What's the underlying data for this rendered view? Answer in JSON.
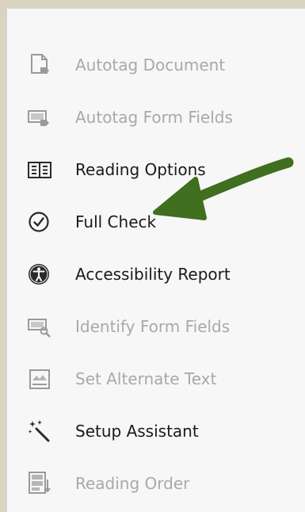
{
  "panel": {
    "items": [
      {
        "label": "Autotag Document",
        "icon": "autotag-document-icon",
        "enabled": false
      },
      {
        "label": "Autotag Form Fields",
        "icon": "autotag-form-fields-icon",
        "enabled": false
      },
      {
        "label": "Reading Options",
        "icon": "reading-options-icon",
        "enabled": true
      },
      {
        "label": "Full Check",
        "icon": "full-check-icon",
        "enabled": true
      },
      {
        "label": "Accessibility Report",
        "icon": "accessibility-report-icon",
        "enabled": true
      },
      {
        "label": "Identify Form Fields",
        "icon": "identify-form-fields-icon",
        "enabled": false
      },
      {
        "label": "Set Alternate Text",
        "icon": "set-alternate-text-icon",
        "enabled": false
      },
      {
        "label": "Setup Assistant",
        "icon": "setup-assistant-icon",
        "enabled": true
      },
      {
        "label": "Reading Order",
        "icon": "reading-order-icon",
        "enabled": false
      }
    ]
  },
  "colors": {
    "background": "#d9d3c0",
    "panel": "#f7f7f7",
    "enabled_text": "#1a1a1a",
    "disabled_text": "#a9a9a9",
    "annotation_arrow": "#3f6f1f"
  }
}
